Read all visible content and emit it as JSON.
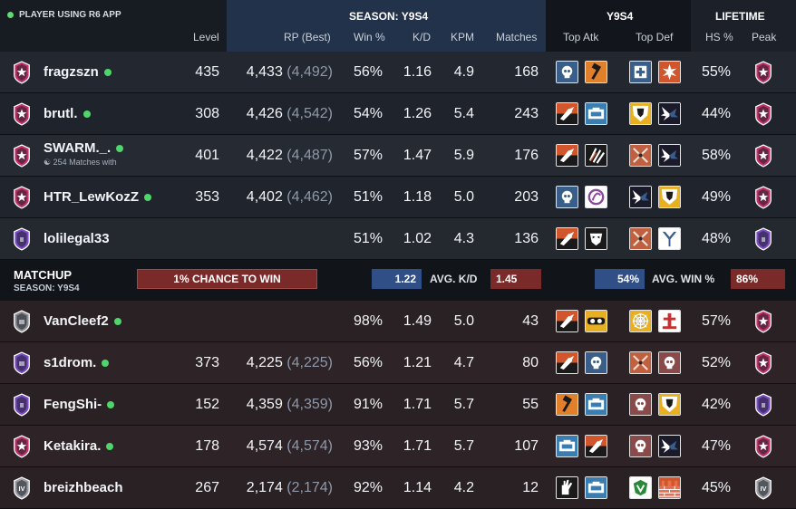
{
  "header": {
    "app_label": "PLAYER USING R6 APP",
    "season_title": "SEASON: Y9S4",
    "y9s4_title": "Y9S4",
    "lifetime_title": "LIFETIME",
    "columns": {
      "level": "Level",
      "rp": "RP (Best)",
      "win": "Win %",
      "kd": "K/D",
      "kpm": "KPM",
      "matches": "Matches",
      "top_atk": "Top Atk",
      "top_def": "Top Def",
      "hs": "HS %",
      "peak": "Peak"
    }
  },
  "team_players": [
    {
      "name": "fragzszn",
      "online": true,
      "sub": "",
      "level": "435",
      "rp": "4,433",
      "best": "(4,492)",
      "win": "56%",
      "kd": "1.16",
      "kpm": "4.9",
      "matches": "168",
      "hs": "55%",
      "rank_color": "#c2316a",
      "rank_tier": "star",
      "peak_color": "#c2316a",
      "peak_tier": "star"
    },
    {
      "name": "brutl.",
      "online": true,
      "sub": "",
      "level": "308",
      "rp": "4,426",
      "best": "(4,542)",
      "win": "54%",
      "kd": "1.26",
      "kpm": "5.4",
      "matches": "243",
      "hs": "44%",
      "rank_color": "#c2316a",
      "rank_tier": "star",
      "peak_color": "#c2316a",
      "peak_tier": "star"
    },
    {
      "name": "SWARM._.",
      "online": true,
      "sub": "254 Matches with",
      "level": "401",
      "rp": "4,422",
      "best": "(4,487)",
      "win": "57%",
      "kd": "1.47",
      "kpm": "5.9",
      "matches": "176",
      "hs": "58%",
      "rank_color": "#c2316a",
      "rank_tier": "star",
      "peak_color": "#c2316a",
      "peak_tier": "star"
    },
    {
      "name": "HTR_LewKozZ",
      "online": true,
      "sub": "",
      "level": "353",
      "rp": "4,402",
      "best": "(4,462)",
      "win": "51%",
      "kd": "1.18",
      "kpm": "5.0",
      "matches": "203",
      "hs": "49%",
      "rank_color": "#c2316a",
      "rank_tier": "star",
      "peak_color": "#c2316a",
      "peak_tier": "star"
    },
    {
      "name": "lolilegal33",
      "online": false,
      "sub": "",
      "level": "",
      "rp": "",
      "best": "",
      "win": "51%",
      "kd": "1.02",
      "kpm": "4.3",
      "matches": "136",
      "hs": "48%",
      "rank_color": "#7b4cc4",
      "rank_tier": "II",
      "peak_color": "#7b4cc4",
      "peak_tier": "II"
    }
  ],
  "matchup": {
    "title": "MATCHUP",
    "season": "SEASON: Y9S4",
    "chance": "1% CHANCE TO WIN",
    "kd_left": "1.22",
    "kd_label": "AVG. K/D",
    "kd_right": "1.45",
    "win_left": "54%",
    "win_label": "AVG. WIN %",
    "win_right": "86%"
  },
  "enemy_players": [
    {
      "name": "VanCleef2",
      "online": true,
      "level": "",
      "rp": "",
      "best": "",
      "win": "98%",
      "kd": "1.49",
      "kpm": "5.0",
      "matches": "43",
      "hs": "57%",
      "rank_color": "#8d8f94",
      "rank_tier": "III",
      "peak_color": "#c2316a",
      "peak_tier": "star"
    },
    {
      "name": "s1drom.",
      "online": true,
      "level": "373",
      "rp": "4,225",
      "best": "(4,225)",
      "win": "56%",
      "kd": "1.21",
      "kpm": "4.7",
      "matches": "80",
      "hs": "52%",
      "rank_color": "#7b4cc4",
      "rank_tier": "III",
      "peak_color": "#c2316a",
      "peak_tier": "star"
    },
    {
      "name": "FengShi-",
      "online": true,
      "level": "152",
      "rp": "4,359",
      "best": "(4,359)",
      "win": "91%",
      "kd": "1.71",
      "kpm": "5.7",
      "matches": "55",
      "hs": "42%",
      "rank_color": "#7b4cc4",
      "rank_tier": "II",
      "peak_color": "#7b4cc4",
      "peak_tier": "II"
    },
    {
      "name": "Ketakira.",
      "online": true,
      "level": "178",
      "rp": "4,574",
      "best": "(4,574)",
      "win": "93%",
      "kd": "1.71",
      "kpm": "5.7",
      "matches": "107",
      "hs": "47%",
      "rank_color": "#c2316a",
      "rank_tier": "star",
      "peak_color": "#c2316a",
      "peak_tier": "star"
    },
    {
      "name": "breizhbeach",
      "online": false,
      "level": "267",
      "rp": "2,174",
      "best": "(2,174)",
      "win": "92%",
      "kd": "1.14",
      "kpm": "4.2",
      "matches": "12",
      "hs": "45%",
      "rank_color": "#9a9ca3",
      "rank_tier": "IV",
      "peak_color": "#9a9ca3",
      "peak_tier": "IV"
    }
  ],
  "team_ops": [
    [
      [
        "#3a5e8a",
        "skull"
      ],
      [
        "#e0802a",
        "hammer"
      ],
      [
        "#3a5e8a",
        "medic"
      ],
      [
        "#d2562c",
        "spike"
      ]
    ],
    [
      [
        "#d2562c",
        "drone"
      ],
      [
        "#3a7db0",
        "camera"
      ],
      [
        "#e8b020",
        "shield"
      ],
      [
        "#3a5e8a",
        "wings"
      ]
    ],
    [
      [
        "#d2562c",
        "drone"
      ],
      [
        "#2a2a2a",
        "claw"
      ],
      [
        "#c06040",
        "sword"
      ],
      [
        "#3a5e8a",
        "wings"
      ]
    ],
    [
      [
        "#3a5e8a",
        "skull"
      ],
      [
        "#8a4a9a",
        "swirl"
      ],
      [
        "#3a5e8a",
        "wings"
      ],
      [
        "#e8b020",
        "shield"
      ]
    ],
    [
      [
        "#d2562c",
        "drone"
      ],
      [
        "#2a2a2a",
        "mask"
      ],
      [
        "#c06040",
        "sword"
      ],
      [
        "#3a5e8a",
        "arrow"
      ]
    ]
  ],
  "enemy_ops": [
    [
      [
        "#d2562c",
        "drone"
      ],
      [
        "#e8b020",
        "goggles"
      ],
      [
        "#e8b020",
        "web"
      ],
      [
        "#c83030",
        "tower"
      ]
    ],
    [
      [
        "#d2562c",
        "drone"
      ],
      [
        "#3a5e8a",
        "skull"
      ],
      [
        "#c06040",
        "sword"
      ],
      [
        "#8a4a4a",
        "skull"
      ]
    ],
    [
      [
        "#e0802a",
        "hammer"
      ],
      [
        "#3a7db0",
        "camera"
      ],
      [
        "#8a4a4a",
        "skull"
      ],
      [
        "#e8b020",
        "shield"
      ]
    ],
    [
      [
        "#3a7db0",
        "camera"
      ],
      [
        "#d2562c",
        "drone"
      ],
      [
        "#8a4a4a",
        "skull"
      ],
      [
        "#3a5e8a",
        "wings"
      ]
    ],
    [
      [
        "#e8e8e8",
        "hand"
      ],
      [
        "#3a7db0",
        "camera"
      ],
      [
        "#2a8a3a",
        "crest"
      ],
      [
        "#d2562c",
        "brick"
      ]
    ]
  ]
}
